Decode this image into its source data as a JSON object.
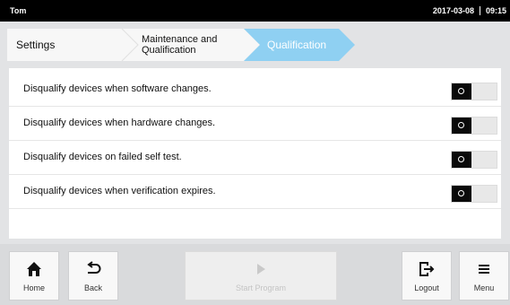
{
  "status_bar": {
    "user": "Tom",
    "date": "2017-03-08",
    "time": "09:15"
  },
  "breadcrumb": {
    "items": [
      {
        "line1": "Settings"
      },
      {
        "line1": "Maintenance and",
        "line2": "Qualification"
      },
      {
        "line1": "Qualification"
      }
    ]
  },
  "settings": [
    {
      "label": "Disqualify devices when software changes.",
      "enabled": true
    },
    {
      "label": "Disqualify devices when hardware changes.",
      "enabled": true
    },
    {
      "label": "Disqualify devices on failed self test.",
      "enabled": true
    },
    {
      "label": "Disqualify devices when verification expires.",
      "enabled": true
    }
  ],
  "footer": {
    "home": {
      "label": "Home",
      "icon": "home-icon"
    },
    "back": {
      "label": "Back",
      "icon": "back-arrow-icon"
    },
    "start": {
      "label": "Start Program",
      "icon": "play-icon",
      "enabled": false
    },
    "logout": {
      "label": "Logout",
      "icon": "logout-icon"
    },
    "menu": {
      "label": "Menu",
      "icon": "menu-icon"
    }
  },
  "colors": {
    "active_tab": "#8fd0f2",
    "top_bar": "#000000",
    "background": "#e2e3e5"
  }
}
